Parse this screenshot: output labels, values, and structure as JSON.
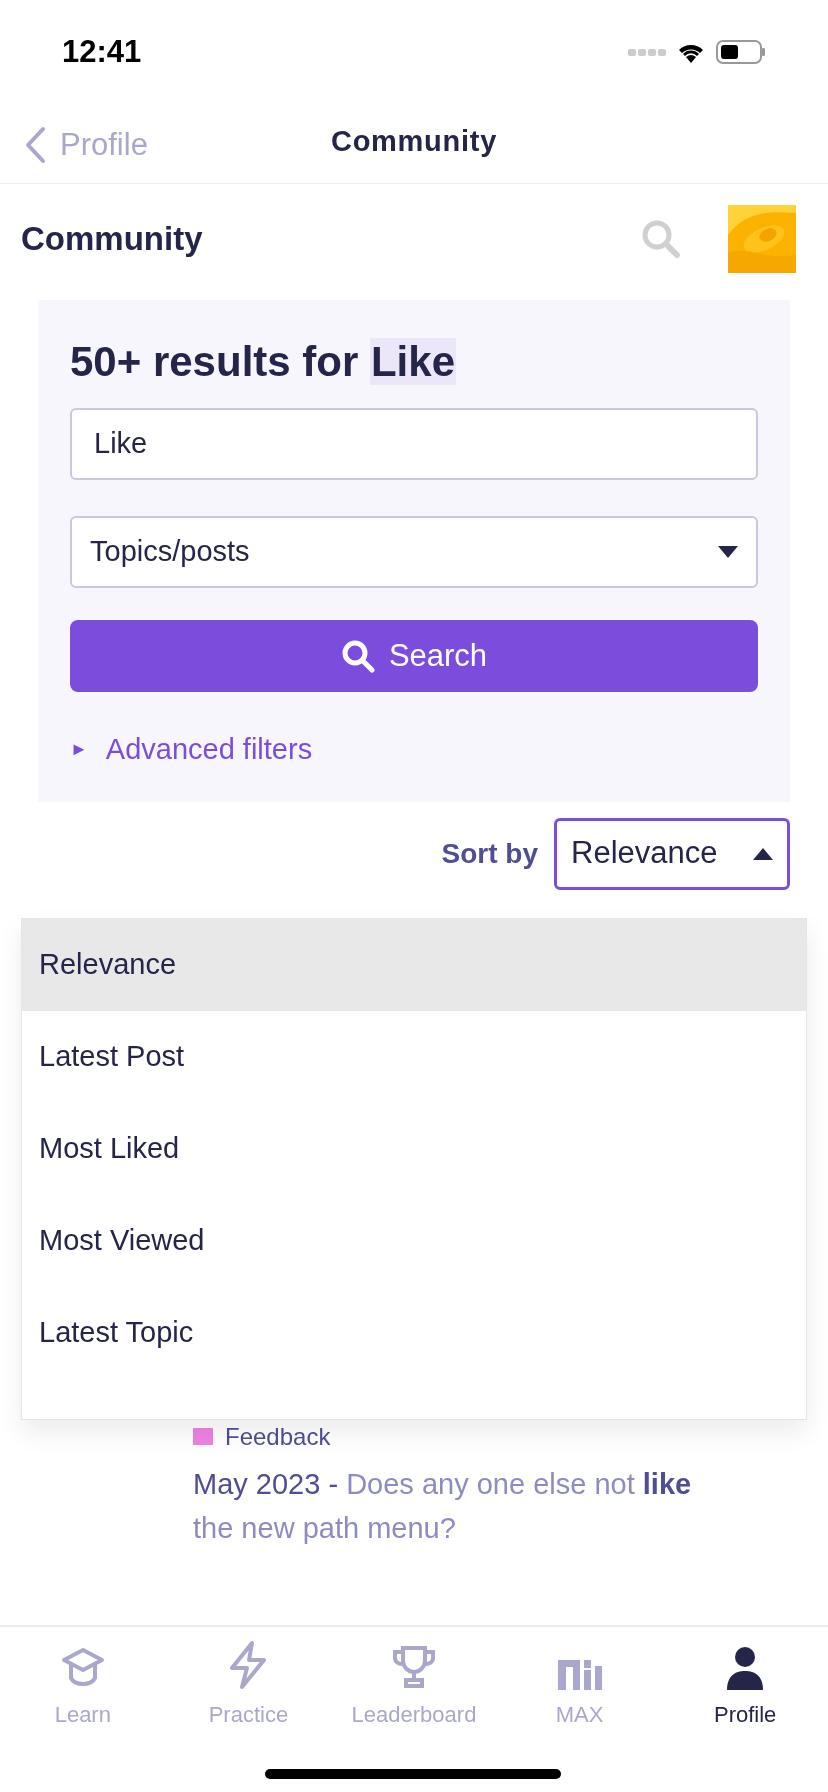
{
  "status_bar": {
    "time": "12:41"
  },
  "nav": {
    "back_label": "Profile",
    "title": "Community"
  },
  "header": {
    "title": "Community"
  },
  "search_panel": {
    "heading": "50+ results for ",
    "term": "Like",
    "query": "Like",
    "scope": "Topics/posts",
    "button": "Search",
    "advanced_toggle": "►",
    "advanced_label": "Advanced filters"
  },
  "sort": {
    "label": "Sort by",
    "value": "Relevance",
    "expanded": true,
    "options": [
      {
        "label": "Relevance",
        "selected": true
      },
      {
        "label": "Latest Post",
        "selected": false
      },
      {
        "label": "Most Liked",
        "selected": false
      },
      {
        "label": "Most Viewed",
        "selected": false
      },
      {
        "label": "Latest Topic",
        "selected": false
      }
    ]
  },
  "results": [
    {
      "category": "Feedback",
      "color": "#ee82e4",
      "date": "May 2023 - ",
      "title": "Does any one else not **like** the new path menu?"
    }
  ],
  "tabs": [
    {
      "label": "Learn",
      "kind": "learn",
      "selected": false
    },
    {
      "label": "Practice",
      "kind": "practice",
      "selected": false
    },
    {
      "label": "Leaderboard",
      "kind": "leaderboard",
      "selected": false
    },
    {
      "label": "MAX",
      "kind": "max",
      "selected": false
    },
    {
      "label": "Profile",
      "kind": "profile",
      "selected": true
    }
  ]
}
